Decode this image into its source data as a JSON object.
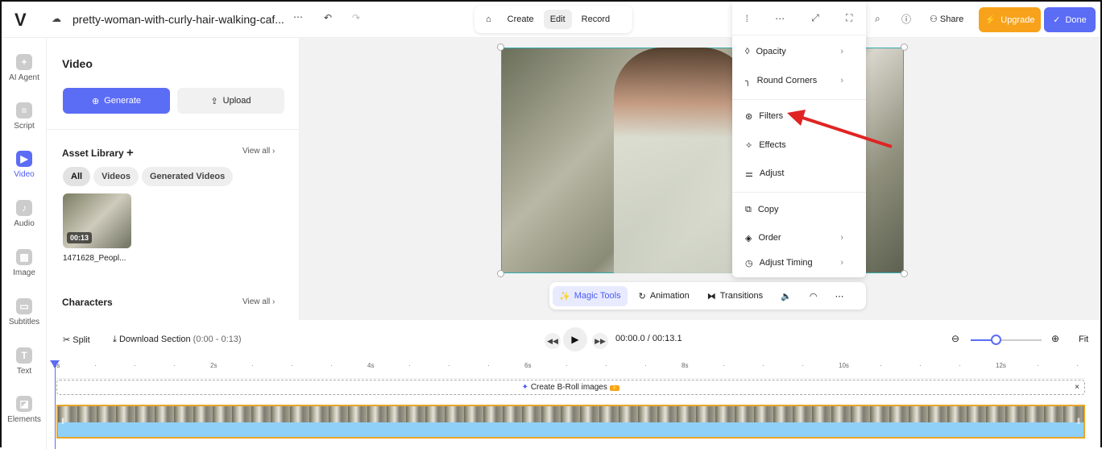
{
  "header": {
    "title": "pretty-woman-with-curly-hair-walking-caf...",
    "share": "Share",
    "upgrade": "Upgrade",
    "done": "Done",
    "modes": [
      "Create",
      "Edit",
      "Record"
    ]
  },
  "rail": [
    {
      "label": "AI Agent"
    },
    {
      "label": "Script"
    },
    {
      "label": "Video"
    },
    {
      "label": "Audio"
    },
    {
      "label": "Image"
    },
    {
      "label": "Subtitles"
    },
    {
      "label": "Text"
    },
    {
      "label": "Elements"
    }
  ],
  "panel": {
    "title": "Video",
    "generate": "Generate",
    "upload": "Upload",
    "asset_library": "Asset Library",
    "view_all": "View all",
    "filters": [
      "All",
      "Videos",
      "Generated Videos"
    ],
    "asset": {
      "duration": "00:13",
      "name": "1471628_Peopl..."
    },
    "characters": "Characters",
    "characters_view_all": "View all"
  },
  "menu": {
    "items": [
      "Opacity",
      "Round Corners",
      "Filters",
      "Effects",
      "Adjust",
      "Copy",
      "Order",
      "Adjust Timing"
    ]
  },
  "toolbar": {
    "magic": "Magic Tools",
    "animation": "Animation",
    "transitions": "Transitions"
  },
  "timeline": {
    "split": "Split",
    "download": "Download Section",
    "range": "(0:00 - 0:13)",
    "current": "00:00.0",
    "sep": "/",
    "total": "00:13.1",
    "fit": "Fit",
    "ticks": [
      "0s",
      "2s",
      "4s",
      "6s",
      "8s",
      "10s",
      "12s"
    ],
    "broll": "Create B-Roll images",
    "zoom_level": 0.35
  },
  "colors": {
    "accent": "#5b6cf5",
    "upgrade": "#f8a21b",
    "clip_border": "#e8a628",
    "arrow": "#e02424"
  }
}
